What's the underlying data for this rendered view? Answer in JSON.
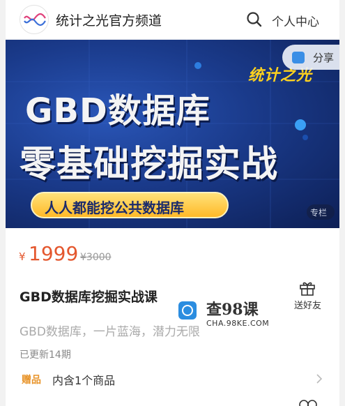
{
  "header": {
    "channel_name": "统计之光官方频道",
    "search_icon": "search-icon",
    "personal_center_label": "个人中心"
  },
  "banner": {
    "brand": "统计之光",
    "title_line1": "GBD数据库",
    "title_line2": "零基础挖掘实战",
    "pill_text": "人人都能挖公共数据库",
    "share_label": "分享",
    "tag_label": "专栏"
  },
  "pricing": {
    "currency_symbol": "¥",
    "price": "1999",
    "original_price": "¥3000"
  },
  "course": {
    "title": "GBD数据库挖掘实战课",
    "subtitle": "GBD数据库，一片蓝海，潜力无限",
    "updated": "已更新14期",
    "gift_button_label": "送好友",
    "gift_tag": "赠品",
    "gift_text": "内含1个商品"
  },
  "watermark": {
    "title": "查98课",
    "url": "CHA.98KE.COM"
  },
  "colors": {
    "price": "#e4572e",
    "gift_tag": "#e8942a",
    "banner_bg": "#1a3a8a",
    "banner_accent": "#ffd21e"
  }
}
